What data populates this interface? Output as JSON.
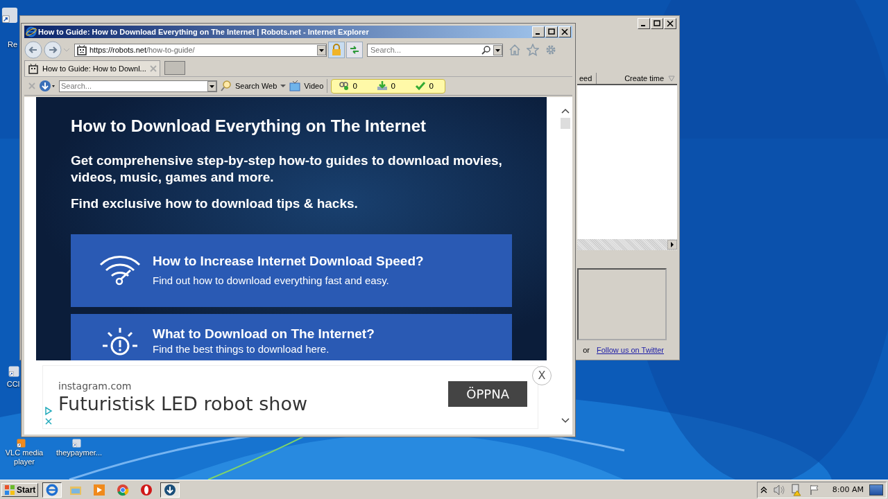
{
  "desktop": {
    "icons": [
      {
        "label": "Re"
      },
      {
        "label": "CCl"
      },
      {
        "label": "VLC media player"
      },
      {
        "label": "theypaymer..."
      }
    ]
  },
  "background_window": {
    "columns": [
      {
        "label": "eed"
      },
      {
        "label": "Create time"
      }
    ],
    "footer_text": "or",
    "footer_link": "Follow us on Twitter"
  },
  "browser": {
    "title": "How to Guide: How to Download Everything on The Internet | Robots.net - Internet Explorer",
    "address": {
      "host": "https://robots.net",
      "path": "/how-to-guide/"
    },
    "search": {
      "placeholder": "Search..."
    },
    "tabs": [
      {
        "label": "How to Guide: How to Downl...",
        "selected": true
      }
    ],
    "toolbar": {
      "search_placeholder": "Search...",
      "search_button": "Search Web",
      "video_button": "Video",
      "counters": [
        "0",
        "0",
        "0"
      ]
    },
    "page": {
      "heading": "How to Download Everything on The Internet",
      "subtitle": "Get comprehensive step-by-step how-to guides to download movies, videos, music, games and more.",
      "tagline": "Find exclusive how to download tips & hacks.",
      "cards": [
        {
          "kind": "wifi",
          "title": "How to Increase Internet Download Speed?",
          "description": "Find out how to download everything fast and easy."
        },
        {
          "kind": "bulb",
          "title": "What to Download on The Internet?",
          "description": "Find the best things to download here."
        }
      ]
    },
    "ad": {
      "domain": "instagram.com",
      "headline": "Futuristisk LED robot show",
      "button": "ÖPPNA",
      "close": "X"
    }
  },
  "taskbar": {
    "start": "Start",
    "apps": [
      {
        "kind": "ie",
        "selected": true
      },
      {
        "kind": "folder",
        "selected": false
      },
      {
        "kind": "media",
        "selected": false
      },
      {
        "kind": "chrome",
        "selected": false
      },
      {
        "kind": "opera",
        "selected": false
      },
      {
        "kind": "download",
        "selected": true
      }
    ],
    "clock": "8:00 AM"
  }
}
